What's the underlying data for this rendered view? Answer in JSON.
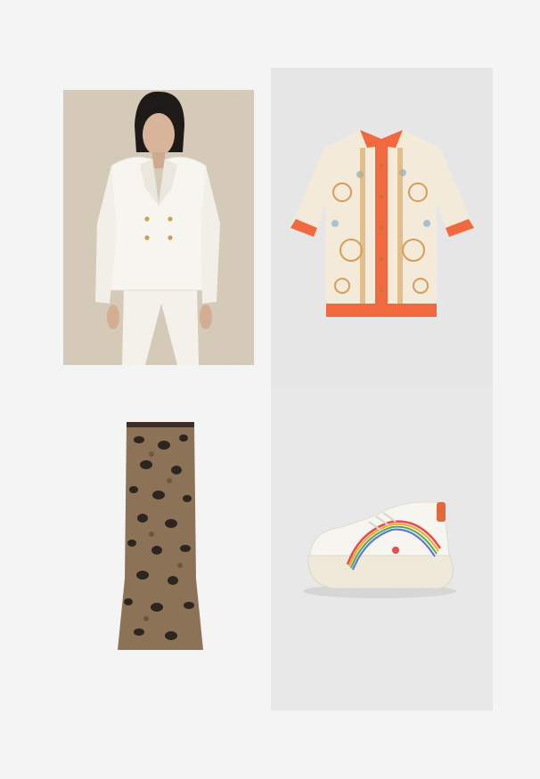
{
  "products": [
    {
      "name": "white-double-breasted-blazer",
      "icon": "blazer-photo"
    },
    {
      "name": "scarf-print-short-sleeve-shirt",
      "icon": "shirt-photo"
    },
    {
      "name": "leopard-print-midi-skirt",
      "icon": "skirt-photo"
    },
    {
      "name": "white-rainbow-platform-sneaker",
      "icon": "sneaker-photo"
    }
  ],
  "colors": {
    "page_background": "#f4f4f4",
    "tile_background": "#e6e6e6",
    "blazer_backdrop": "#d9cdbd",
    "shirt_accent": "#f0693f",
    "leopard_base": "#8c7358"
  }
}
